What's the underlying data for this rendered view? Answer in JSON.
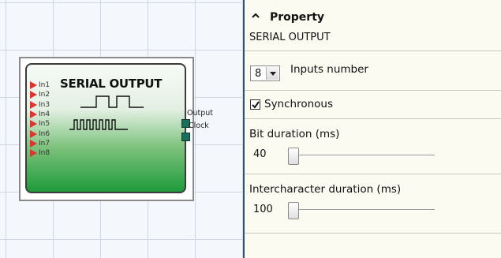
{
  "canvas": {
    "block": {
      "title": "SERIAL OUTPUT",
      "inputs": [
        "In1",
        "In2",
        "In3",
        "In4",
        "In5",
        "In6",
        "In7",
        "In8"
      ],
      "outputs": [
        "Output",
        "Clock"
      ]
    }
  },
  "panel": {
    "header": {
      "title": "Property",
      "subtitle": "SERIAL OUTPUT"
    },
    "inputs_number": {
      "value": "8",
      "label": "Inputs number"
    },
    "synchronous": {
      "label": "Synchronous",
      "checked": true
    },
    "bit_duration": {
      "label": "Bit duration (ms)",
      "value": "40"
    },
    "intercharacter_duration": {
      "label": "Intercharacter duration (ms)",
      "value": "100"
    }
  },
  "colors": {
    "input_port": "#e2342f",
    "output_port": "#1b6e5a",
    "block_green": "#1e9b3a"
  }
}
